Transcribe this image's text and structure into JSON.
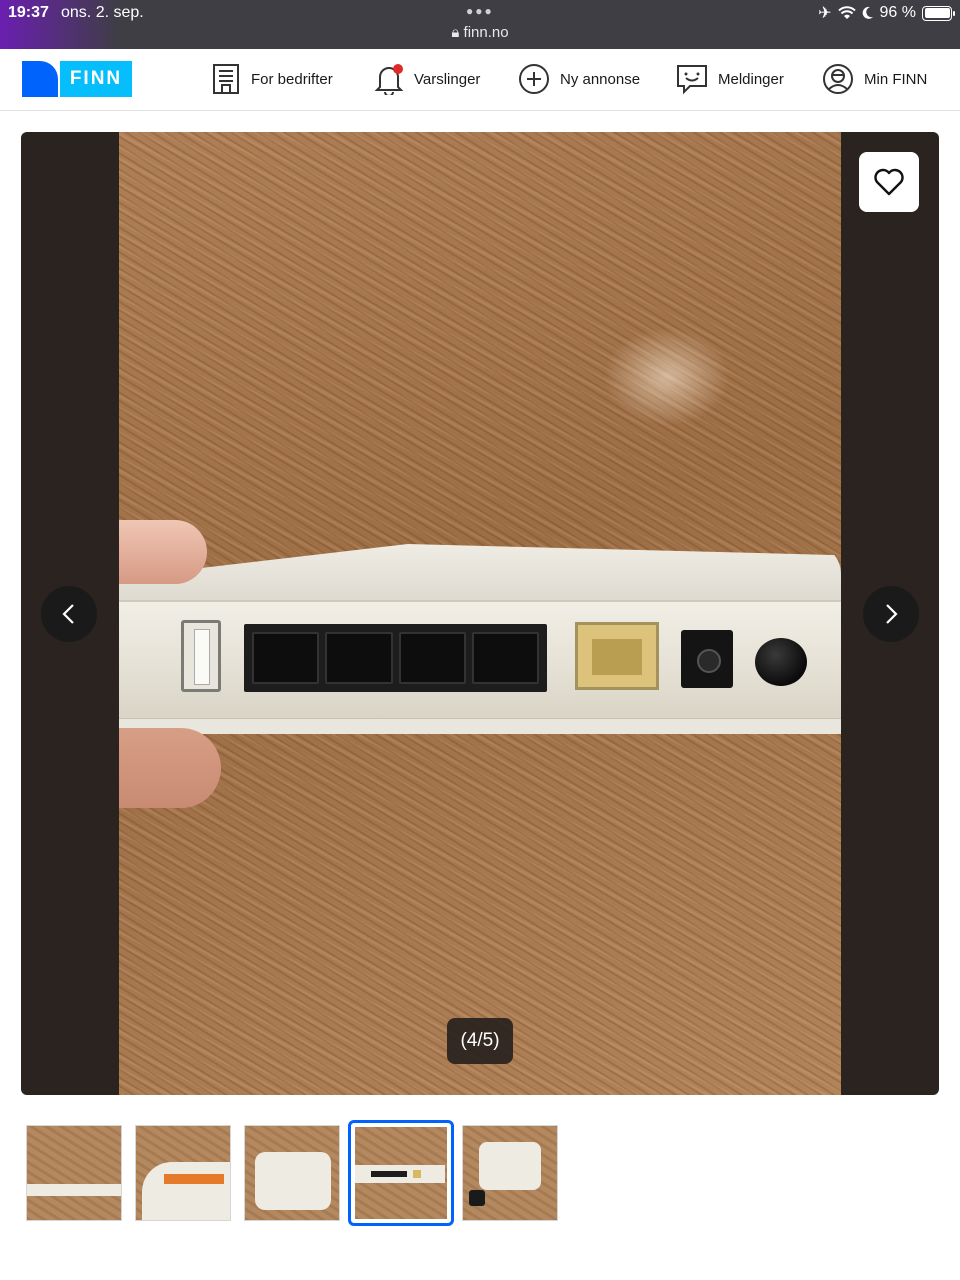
{
  "status_bar": {
    "time": "19:37",
    "date": "ons. 2. sep.",
    "url": "finn.no",
    "battery": "96 %"
  },
  "nav": {
    "logo_text": "FINN",
    "items": [
      {
        "label": "For bedrifter",
        "icon": "building-icon"
      },
      {
        "label": "Varslinger",
        "icon": "bell-icon"
      },
      {
        "label": "Ny annonse",
        "icon": "plus-circle-icon"
      },
      {
        "label": "Meldinger",
        "icon": "chat-icon"
      },
      {
        "label": "Min FINN",
        "icon": "user-circle-icon"
      }
    ]
  },
  "gallery": {
    "counter": "(4/5)",
    "current_index": 4,
    "total": 5
  },
  "colors": {
    "brand_dark": "#0063fb",
    "brand_light": "#06befb",
    "notification": "#e02a2a",
    "selected_border": "#0063fb"
  }
}
